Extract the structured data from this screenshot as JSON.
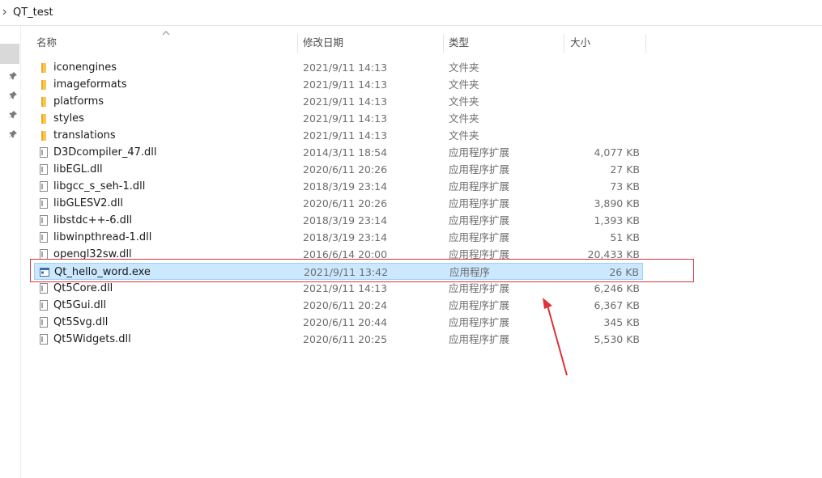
{
  "address_bar": {
    "title": "QT_test"
  },
  "columns": {
    "name": "名称",
    "date": "修改日期",
    "type": "类型",
    "size": "大小"
  },
  "files": [
    {
      "name": "iconengines",
      "date": "2021/9/11 14:13",
      "type": "文件夹",
      "size": "",
      "icon": "folder-icon"
    },
    {
      "name": "imageformats",
      "date": "2021/9/11 14:13",
      "type": "文件夹",
      "size": "",
      "icon": "folder-icon"
    },
    {
      "name": "platforms",
      "date": "2021/9/11 14:13",
      "type": "文件夹",
      "size": "",
      "icon": "folder-icon"
    },
    {
      "name": "styles",
      "date": "2021/9/11 14:13",
      "type": "文件夹",
      "size": "",
      "icon": "folder-icon"
    },
    {
      "name": "translations",
      "date": "2021/9/11 14:13",
      "type": "文件夹",
      "size": "",
      "icon": "folder-icon"
    },
    {
      "name": "D3Dcompiler_47.dll",
      "date": "2014/3/11 18:54",
      "type": "应用程序扩展",
      "size": "4,077 KB",
      "icon": "dll-file-icon"
    },
    {
      "name": "libEGL.dll",
      "date": "2020/6/11 20:26",
      "type": "应用程序扩展",
      "size": "27 KB",
      "icon": "dll-file-icon"
    },
    {
      "name": "libgcc_s_seh-1.dll",
      "date": "2018/3/19 23:14",
      "type": "应用程序扩展",
      "size": "73 KB",
      "icon": "dll-file-icon"
    },
    {
      "name": "libGLESV2.dll",
      "date": "2020/6/11 20:26",
      "type": "应用程序扩展",
      "size": "3,890 KB",
      "icon": "dll-file-icon"
    },
    {
      "name": "libstdc++-6.dll",
      "date": "2018/3/19 23:14",
      "type": "应用程序扩展",
      "size": "1,393 KB",
      "icon": "dll-file-icon"
    },
    {
      "name": "libwinpthread-1.dll",
      "date": "2018/3/19 23:14",
      "type": "应用程序扩展",
      "size": "51 KB",
      "icon": "dll-file-icon"
    },
    {
      "name": "opengl32sw.dll",
      "date": "2016/6/14 20:00",
      "type": "应用程序扩展",
      "size": "20,433 KB",
      "icon": "dll-file-icon"
    },
    {
      "name": "Qt_hello_word.exe",
      "date": "2021/9/11 13:42",
      "type": "应用程序",
      "size": "26 KB",
      "icon": "exe-file-icon",
      "selected": true
    },
    {
      "name": "Qt5Core.dll",
      "date": "2021/9/11 14:13",
      "type": "应用程序扩展",
      "size": "6,246 KB",
      "icon": "dll-file-icon"
    },
    {
      "name": "Qt5Gui.dll",
      "date": "2020/6/11 20:24",
      "type": "应用程序扩展",
      "size": "6,367 KB",
      "icon": "dll-file-icon"
    },
    {
      "name": "Qt5Svg.dll",
      "date": "2020/6/11 20:44",
      "type": "应用程序扩展",
      "size": "345 KB",
      "icon": "dll-file-icon"
    },
    {
      "name": "Qt5Widgets.dll",
      "date": "2020/6/11 20:25",
      "type": "应用程序扩展",
      "size": "5,530 KB",
      "icon": "dll-file-icon"
    }
  ],
  "colors": {
    "selection_bg": "#cce8ff",
    "selection_border": "#99d1ff",
    "folder": "#f8c853",
    "annotation": "#d9363e"
  },
  "icons": {
    "address_chevron": "chevron-right-icon",
    "sort": "sort-up-icon",
    "pin": "pin-icon"
  }
}
